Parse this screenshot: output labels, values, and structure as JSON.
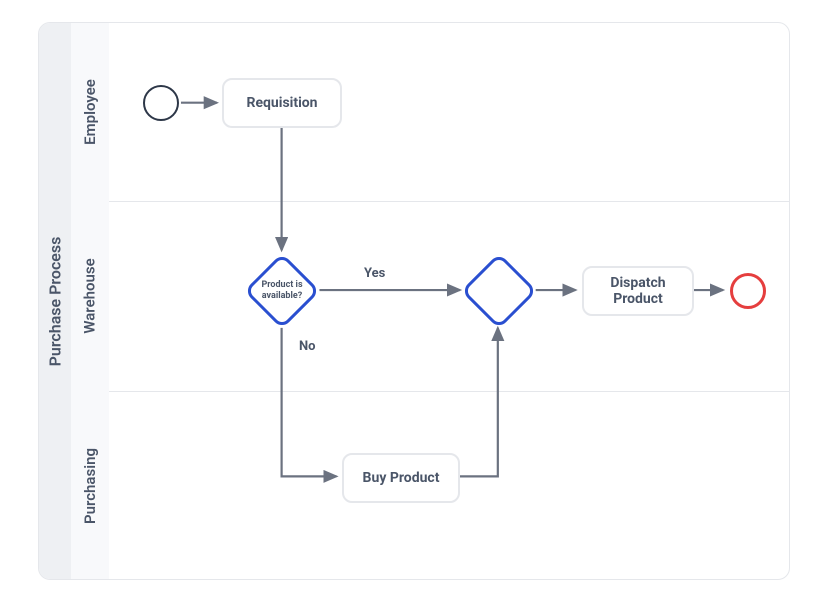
{
  "pool": {
    "label": "Purchase Process"
  },
  "lanes": [
    {
      "label": "Employee"
    },
    {
      "label": "Warehouse"
    },
    {
      "label": "Purchasing"
    }
  ],
  "nodes": {
    "requisition": {
      "label": "Requisition"
    },
    "gateway1": {
      "label": "Product is available?"
    },
    "dispatch": {
      "label": "Dispatch Product"
    },
    "buy": {
      "label": "Buy Product"
    }
  },
  "edges": {
    "yes": "Yes",
    "no": "No"
  }
}
